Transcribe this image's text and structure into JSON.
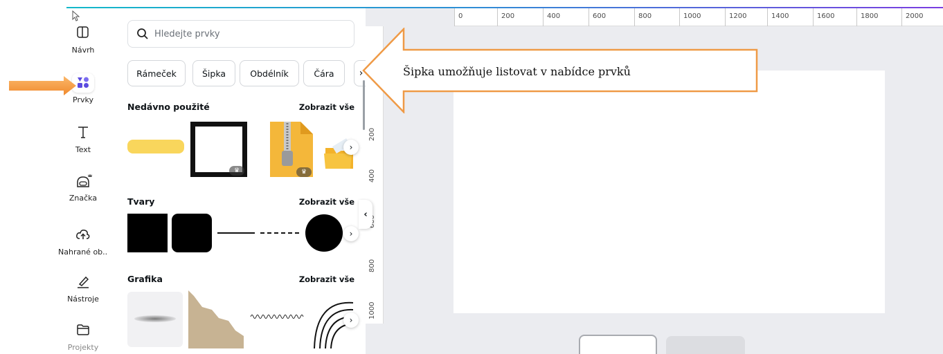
{
  "rail": {
    "items": [
      {
        "label": "Návrh",
        "icon": "layout-icon"
      },
      {
        "label": "Prvky",
        "icon": "elements-icon"
      },
      {
        "label": "Text",
        "icon": "text-icon"
      },
      {
        "label": "Značka",
        "icon": "brand-icon"
      },
      {
        "label": "Nahrané ob...",
        "icon": "upload-icon"
      },
      {
        "label": "Nástroje",
        "icon": "tools-icon"
      },
      {
        "label": "Projekty",
        "icon": "folder-icon"
      }
    ]
  },
  "search": {
    "placeholder": "Hledejte prvky"
  },
  "chips": [
    "Rámeček",
    "Šipka",
    "Obdélník",
    "Čára"
  ],
  "sections": {
    "recent": {
      "title": "Nedávno použité",
      "see_all": "Zobrazit vše"
    },
    "shapes": {
      "title": "Tvary",
      "see_all": "Zobrazit vše"
    },
    "graphics": {
      "title": "Grafika",
      "see_all": "Zobrazit vše"
    }
  },
  "ruler": {
    "top": [
      "0",
      "200",
      "400",
      "600",
      "800",
      "1000",
      "1200",
      "1400",
      "1600",
      "1800",
      "2000"
    ],
    "left": [
      "200",
      "400",
      "600",
      "800",
      "1000"
    ]
  },
  "callout": {
    "text": "Šipka umožňuje listovat v nabídce prvků"
  },
  "colors": {
    "accent": "#f5a24a",
    "callout_border": "#ef9a46",
    "selected_icon": "#5b4be0"
  }
}
